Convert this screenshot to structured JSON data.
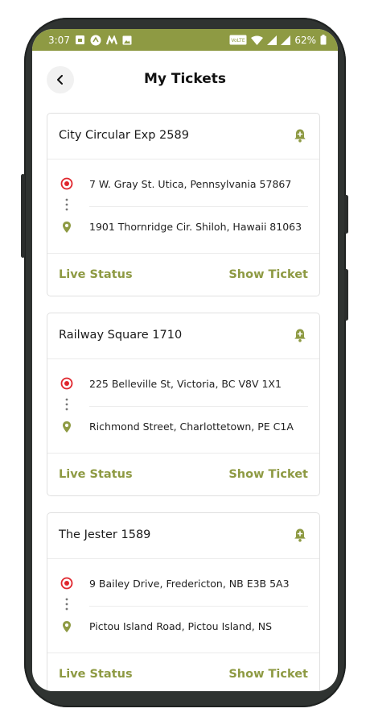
{
  "status_bar": {
    "time": "3:07",
    "battery": "62%",
    "left_icons": [
      "sim-card-icon",
      "upload-icon",
      "maps-icon",
      "image-icon"
    ],
    "right_icons": [
      "volte-icon",
      "wifi-icon",
      "signal-icon",
      "signal-icon",
      "battery-icon"
    ],
    "volte_text": "VoLTE"
  },
  "header": {
    "title": "My Tickets"
  },
  "colors": {
    "accent": "#8e9a43",
    "origin": "#e0262d",
    "destination": "#8e9a43"
  },
  "tickets": [
    {
      "title": "City Circular Exp 2589",
      "from": "7 W. Gray St. Utica, Pennsylvania 57867",
      "to": "1901 Thornridge Cir. Shiloh, Hawaii 81063",
      "live_label": "Live Status",
      "show_label": "Show Ticket"
    },
    {
      "title": "Railway Square 1710",
      "from": "225 Belleville St, Victoria, BC V8V 1X1",
      "to": "Richmond Street, Charlottetown, PE C1A",
      "live_label": "Live Status",
      "show_label": "Show Ticket"
    },
    {
      "title": "The Jester 1589",
      "from": "9 Bailey Drive, Fredericton, NB E3B 5A3",
      "to": "Pictou Island Road, Pictou Island, NS",
      "live_label": "Live Status",
      "show_label": "Show Ticket"
    }
  ]
}
